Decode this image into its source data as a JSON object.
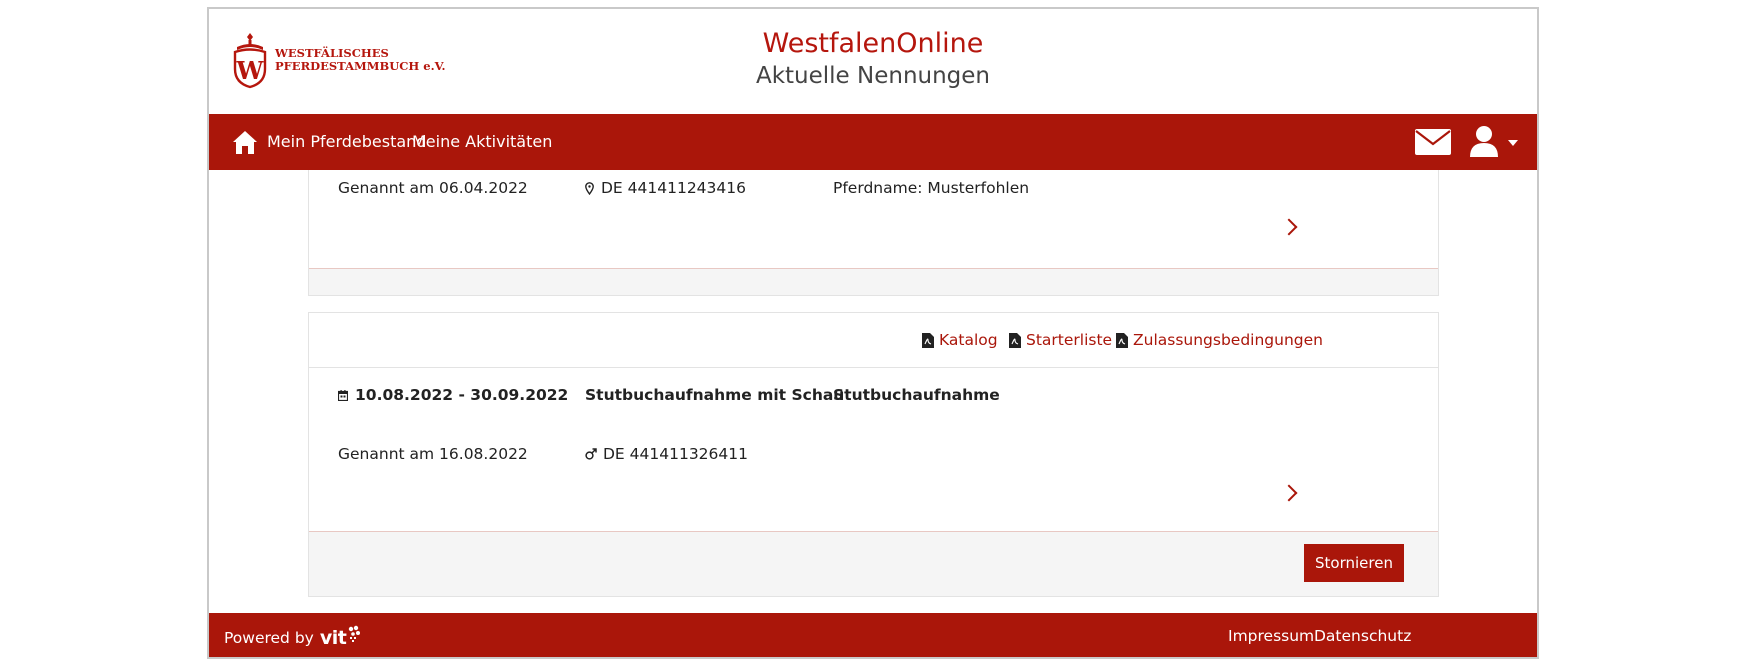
{
  "header": {
    "logo_line1": "WESTFÄLISCHES",
    "logo_line2": "PFERDESTAMMBUCH e.V.",
    "logo_letter": "W",
    "title": "WestfalenOnline",
    "subtitle": "Aktuelle Nennungen"
  },
  "nav": {
    "home_icon": "home-icon",
    "items": [
      "Mein Pferdebestand",
      "Meine Aktivitäten"
    ],
    "mail_icon": "envelope-icon",
    "user_icon": "user-icon"
  },
  "entries": [
    {
      "genannt": "Genannt am 06.04.2022",
      "horse_id": "DE 441411243416",
      "horse_icon": "map-pin-icon",
      "pferdname": "Pferdname: Musterfohlen"
    },
    {
      "docs": [
        "Katalog",
        "Starterliste",
        "Zulassungsbedingungen"
      ],
      "date_range": "10.08.2022 - 30.09.2022",
      "event": "Stutbuchaufnahme mit Schau",
      "type": "Stutbuchaufnahme",
      "genannt": "Genannt am 16.08.2022",
      "horse_id": "DE 441411326411",
      "horse_icon": "male-symbol-icon",
      "button": "Stornieren"
    }
  ],
  "footer": {
    "powered_by": "Powered by",
    "brand": "vit",
    "links": [
      "Impressum",
      "Datenschutz"
    ]
  },
  "colors": {
    "brand_red": "#aa160a",
    "title_red": "#b5160d"
  }
}
